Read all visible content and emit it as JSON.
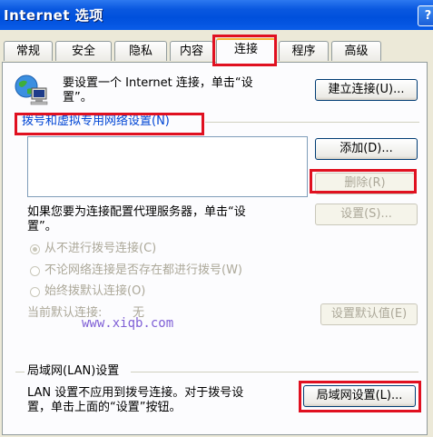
{
  "window": {
    "title": "Internet 选项",
    "help_label": "?"
  },
  "tabs": [
    "常规",
    "安全",
    "隐私",
    "内容",
    "连接",
    "程序",
    "高级"
  ],
  "active_tab": "连接",
  "setup": {
    "description_line1": "要设置一个 Internet 连接，单击“设",
    "description_line2": "置”。",
    "button": "建立连接(U)..."
  },
  "dialup": {
    "section_title": "拨号和虚拟专用网络设置(N)",
    "add_button": "添加(D)...",
    "remove_button": "删除(R)",
    "settings_button": "设置(S)...",
    "proxy_text_line1": "如果您要为连接配置代理服务器，单击“设",
    "proxy_text_line2": "置”。",
    "options": [
      {
        "label": "从不进行拨号连接(C)",
        "checked": true
      },
      {
        "label": "不论网络连接是否存在都进行拨号(W)",
        "checked": false
      },
      {
        "label": "始终拨默认连接(O)",
        "checked": false
      }
    ],
    "current_default_label": "当前默认连接:",
    "current_default_value": "无",
    "set_default_button": "设置默认值(E)"
  },
  "watermark": "www.xiqb.com",
  "lan": {
    "section_title": "局域网(LAN)设置",
    "text_line1": "LAN 设置不应用到拨号连接。对于拨号设",
    "text_line2": "置，单击上面的“设置”按钮。",
    "button": "局域网设置(L)..."
  },
  "colors": {
    "title_bar": "#0a58e0",
    "highlight": "#e01020",
    "disabled_text": "#aca899"
  }
}
